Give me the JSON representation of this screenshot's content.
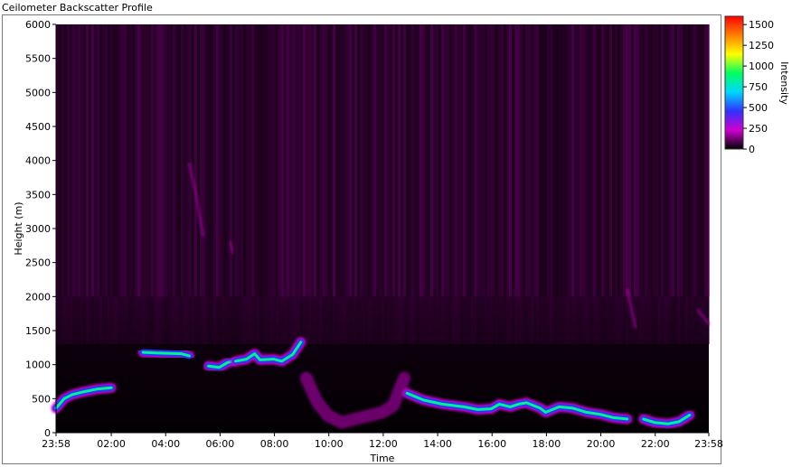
{
  "window": {
    "title": "Ceilometer Backscatter Profile"
  },
  "chart_data": {
    "type": "heatmap",
    "title": "",
    "xlabel": "Time",
    "ylabel": "Height (m)",
    "ylim": [
      0,
      6000
    ],
    "x_ticks": [
      "23:58",
      "02:00",
      "04:00",
      "06:00",
      "08:00",
      "10:00",
      "12:00",
      "14:00",
      "16:00",
      "18:00",
      "20:00",
      "22:00",
      "23:58"
    ],
    "x_tick_hours": [
      0,
      2.03,
      4.03,
      6.03,
      8.03,
      10.03,
      12.03,
      14.03,
      16.03,
      18.03,
      20.03,
      22.03,
      24
    ],
    "xlim_hours": [
      0,
      24
    ],
    "y_ticks": [
      0,
      500,
      1000,
      1500,
      2000,
      2500,
      3000,
      3500,
      4000,
      4500,
      5000,
      5500,
      6000
    ],
    "colorbar": {
      "label": "Intensity",
      "range": [
        0,
        1600
      ],
      "ticks": [
        0,
        250,
        500,
        750,
        1000,
        1250,
        1500
      ],
      "colors": [
        "#000000",
        "#d000d0",
        "#3030ff",
        "#00d8ff",
        "#00ff60",
        "#ffff00",
        "#ff8000",
        "#ff0000"
      ]
    },
    "grid": false,
    "layers": [
      {
        "name": "cloud-base",
        "intensity": 850,
        "segments": [
          [
            [
              0.0,
              360
            ],
            [
              0.3,
              500
            ],
            [
              0.6,
              560
            ],
            [
              1.0,
              600
            ],
            [
              1.5,
              640
            ],
            [
              2.03,
              660
            ]
          ],
          [
            [
              3.2,
              1180
            ],
            [
              3.8,
              1170
            ],
            [
              4.6,
              1160
            ],
            [
              4.9,
              1130
            ]
          ],
          [
            [
              5.6,
              980
            ],
            [
              6.0,
              960
            ],
            [
              6.3,
              1030
            ],
            [
              6.5,
              1050
            ]
          ],
          [
            [
              6.6,
              1050
            ],
            [
              7.0,
              1080
            ],
            [
              7.3,
              1160
            ],
            [
              7.5,
              1070
            ],
            [
              8.0,
              1080
            ],
            [
              8.3,
              1050
            ],
            [
              8.7,
              1150
            ],
            [
              9.0,
              1330
            ]
          ],
          [
            [
              12.9,
              580
            ],
            [
              13.5,
              480
            ],
            [
              14.2,
              420
            ],
            [
              15.0,
              380
            ],
            [
              15.5,
              340
            ],
            [
              16.0,
              350
            ],
            [
              16.3,
              420
            ],
            [
              16.7,
              380
            ],
            [
              17.0,
              420
            ],
            [
              17.3,
              440
            ],
            [
              17.8,
              360
            ],
            [
              18.0,
              300
            ],
            [
              18.5,
              380
            ],
            [
              19.0,
              360
            ],
            [
              19.5,
              300
            ],
            [
              20.0,
              270
            ],
            [
              20.5,
              220
            ],
            [
              21.0,
              200
            ]
          ],
          [
            [
              21.6,
              200
            ],
            [
              22.0,
              150
            ],
            [
              22.5,
              130
            ],
            [
              22.9,
              160
            ],
            [
              23.3,
              260
            ]
          ]
        ]
      },
      {
        "name": "faint-streaks",
        "intensity": 200,
        "segments": [
          [
            [
              4.9,
              3950
            ],
            [
              5.1,
              3600
            ],
            [
              5.4,
              2900
            ]
          ],
          [
            [
              6.4,
              2800
            ],
            [
              6.5,
              2650
            ]
          ],
          [
            [
              21.0,
              2100
            ],
            [
              21.3,
              1550
            ]
          ],
          [
            [
              23.6,
              1800
            ],
            [
              24.0,
              1600
            ]
          ]
        ]
      },
      {
        "name": "low-boundary-layer",
        "intensity": 250,
        "segments": [
          [
            [
              9.2,
              800
            ],
            [
              9.6,
              450
            ],
            [
              10.0,
              250
            ],
            [
              10.5,
              150
            ],
            [
              11.0,
              200
            ],
            [
              11.5,
              250
            ],
            [
              12.0,
              300
            ],
            [
              12.4,
              400
            ],
            [
              12.8,
              800
            ]
          ]
        ]
      }
    ]
  }
}
